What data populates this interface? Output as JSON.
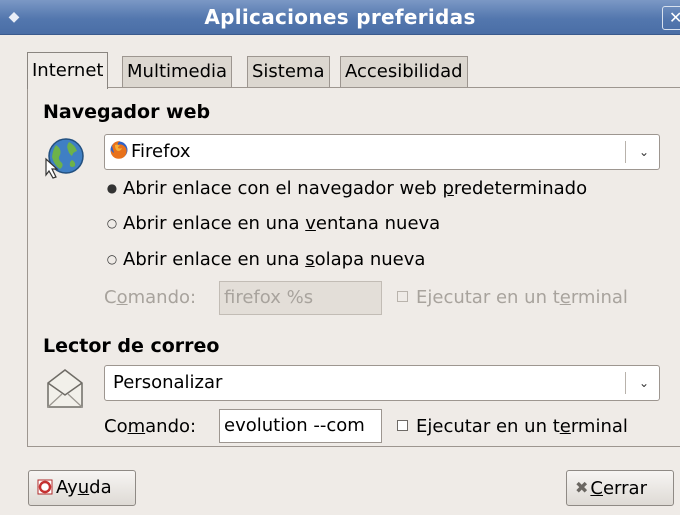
{
  "window": {
    "title": "Aplicaciones preferidas",
    "menu_glyph": "◆",
    "close_glyph": "✕"
  },
  "tabs": [
    {
      "label": "Internet",
      "active": true
    },
    {
      "label": "Multimedia",
      "active": false
    },
    {
      "label": "Sistema",
      "active": false
    },
    {
      "label": "Accesibilidad",
      "active": false
    }
  ],
  "browser": {
    "section_title": "Navegador web",
    "icon": "globe-pointer-icon",
    "selected": "Firefox",
    "selected_icon": "firefox-icon",
    "options": [
      {
        "pre": "Abrir enlace con el navegador web ",
        "key": "p",
        "post": "redeterminado",
        "checked": true
      },
      {
        "pre": "Abrir enlace en una ",
        "key": "v",
        "post": "entana nueva",
        "checked": false
      },
      {
        "pre": "Abrir enlace en una ",
        "key": "s",
        "post": "olapa nueva",
        "checked": false
      }
    ],
    "command_pre": "C",
    "command_key": "o",
    "command_post": "mando:",
    "command_value": "firefox %s",
    "terminal_pre": "Ejecutar en un t",
    "terminal_key": "e",
    "terminal_post": "rminal",
    "enabled": false
  },
  "mail": {
    "section_title": "Lector de correo",
    "icon": "envelope-icon",
    "selected": "Personalizar",
    "command_pre": "Co",
    "command_key": "m",
    "command_post": "ando:",
    "command_value": "evolution --com",
    "terminal_pre": "Ejecutar en un t",
    "terminal_key": "e",
    "terminal_post": "rminal",
    "enabled": true
  },
  "buttons": {
    "help_pre": "Ay",
    "help_key": "u",
    "help_post": "da",
    "close_pre": "",
    "close_key": "C",
    "close_post": "errar"
  },
  "colors": {
    "title_bar": "#5377ae",
    "window_bg": "#efebe7"
  }
}
